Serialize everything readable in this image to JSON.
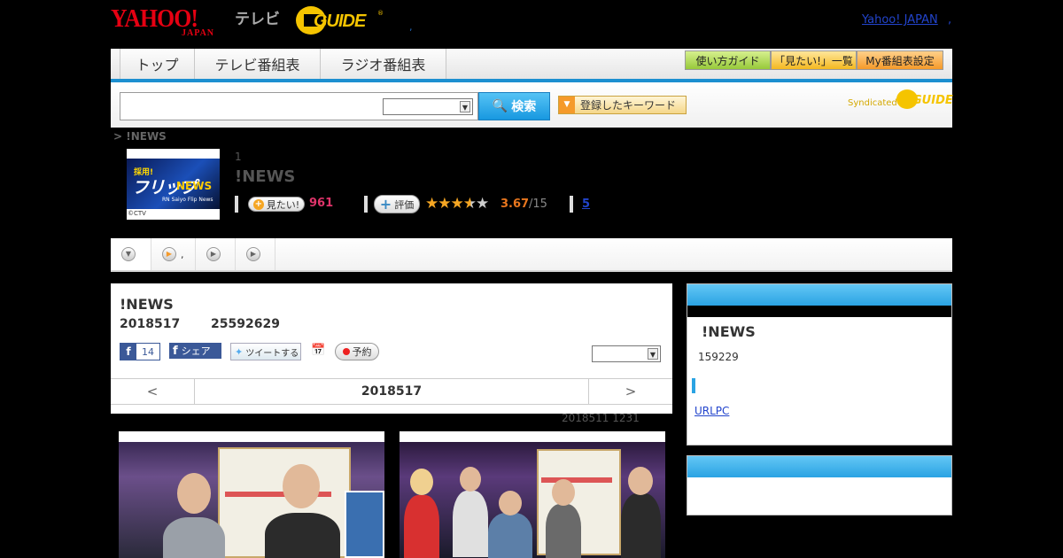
{
  "header": {
    "yahoo_logo": "YAHOO!",
    "yahoo_sub": "JAPAN",
    "tv_label": "テレビ",
    "gguide_logo": "GUIDE",
    "gguide_reg": "®",
    "dot": ",",
    "yahoo_japan_link": "Yahoo! JAPAN",
    "link_dot": ","
  },
  "nav": {
    "tabs": [
      {
        "label": "トップ"
      },
      {
        "label": "テレビ番組表"
      },
      {
        "label": "ラジオ番組表"
      }
    ],
    "buttons": [
      {
        "label": "使い方ガイド"
      },
      {
        "label": "「見たい!」一覧"
      },
      {
        "label": "My番組表設定"
      }
    ]
  },
  "search": {
    "placeholder": "",
    "button_label": "検索",
    "keyword_button": "登録したキーワード",
    "syndicated": "Syndicated",
    "synd_logo": "GUIDE"
  },
  "breadcrumb": "> !NEWS",
  "program": {
    "thumb_text1": "採用!",
    "thumb_text2": "フリップ",
    "thumb_text3": "NEWS",
    "thumb_text4": "RN Saiyo Flip News",
    "copyright": "©CTV",
    "number": "1",
    "title": "!NEWS",
    "mitai_label": "見たい!",
    "mitai_count": "961",
    "hyouka_label": "評価",
    "rating": 3.67,
    "rating_text": "3.67",
    "rating_count": "/15",
    "review_count": "5"
  },
  "tabs": [
    {
      "label": ""
    },
    {
      "label": ","
    },
    {
      "label": ""
    },
    {
      "label": ""
    }
  ],
  "main": {
    "title": "!NEWS",
    "date": "2018517",
    "time": "25592629",
    "fb_letter": "f",
    "fb_count": "14",
    "fb_share": "シェア",
    "tweet": "ツイートする",
    "yoyaku": "予約",
    "nav_prev": "<",
    "nav_date": "2018517",
    "nav_next": ">"
  },
  "updated": "2018511  1231",
  "side": {
    "title": "!NEWS",
    "number": "159229",
    "link": "URLPC"
  },
  "colors": {
    "accent_blue": "#1c8fd0",
    "mitai_pink": "#e0346a",
    "rating_orange": "#e8761e",
    "gguide_yellow": "#f5c400",
    "yahoo_red": "#e60012"
  }
}
